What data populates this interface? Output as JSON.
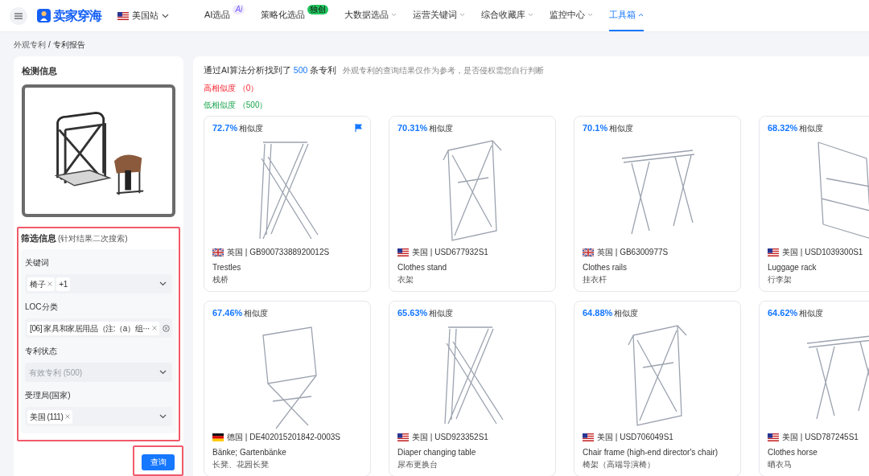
{
  "header": {
    "site": "美国站",
    "logo_text": "卖家穿海",
    "nav": [
      {
        "label": "AI选品",
        "badge": {
          "text": "Ai",
          "kind": "ai"
        },
        "caret": false,
        "selected": false
      },
      {
        "label": "策略化选品",
        "badge": {
          "text": "独创",
          "kind": "new"
        },
        "caret": false,
        "selected": false
      },
      {
        "label": "大数据选品",
        "caret": true,
        "selected": false
      },
      {
        "label": "运营关键词",
        "caret": true,
        "selected": false
      },
      {
        "label": "综合收藏库",
        "caret": true,
        "selected": false
      },
      {
        "label": "监控中心",
        "caret": true,
        "selected": false
      },
      {
        "label": "工具箱",
        "caret": true,
        "selected": true
      }
    ]
  },
  "breadcrumb": {
    "items": [
      "外观专利",
      "专利报告"
    ],
    "separator": "/"
  },
  "sidebar": {
    "title": "检测信息",
    "filter": {
      "title": "筛选信息",
      "note": "(针对结果二次搜索)",
      "fields": [
        {
          "label": "关键词",
          "tags": [
            {
              "text": "椅子",
              "removable": true
            },
            {
              "text": "+1",
              "removable": false
            }
          ],
          "clearable": false,
          "disabled": false
        },
        {
          "label": "LOC分类",
          "tags": [
            {
              "text": "[06] 家具和家居用品（注:（a）组···",
              "removable": true
            }
          ],
          "clearable": true,
          "disabled": false
        },
        {
          "label": "专利状态",
          "placeholder": "有效专利 (500)",
          "clearable": false,
          "disabled": true
        },
        {
          "label": "受理局(国家)",
          "tags": [
            {
              "text": "美国 (111)",
              "removable": true
            }
          ],
          "clearable": false,
          "disabled": false
        }
      ]
    },
    "query_button": "查询"
  },
  "results": {
    "summary_prefix": "通过AI算法分析找到了",
    "summary_count": "500",
    "summary_suffix": "条专利",
    "disclaimer": "外观专利的查询结果仅作为参考，是否侵权需您自行判断",
    "groups": [
      {
        "label": "高相似度",
        "count": "（0）",
        "kind": "high"
      },
      {
        "label": "低相似度",
        "count": "（500）",
        "kind": "low"
      }
    ],
    "cards": [
      {
        "score": "72.7%",
        "score_label": "相似度",
        "flagged": true,
        "country": {
          "kind": "gb",
          "text": "英国 | GB90073388920012S"
        },
        "title": "Trestles",
        "subtitle": "栈桥"
      },
      {
        "score": "70.31%",
        "score_label": "相似度",
        "flagged": false,
        "country": {
          "kind": "us",
          "text": "美国 | USD677932S1"
        },
        "title": "Clothes stand",
        "subtitle": "衣架"
      },
      {
        "score": "70.1%",
        "score_label": "相似度",
        "flagged": false,
        "country": {
          "kind": "gb",
          "text": "英国 | GB6300977S"
        },
        "title": "Clothes rails",
        "subtitle": "挂衣杆"
      },
      {
        "score": "68.32%",
        "score_label": "相似度",
        "flagged": false,
        "country": {
          "kind": "us",
          "text": "美国 | USD1039300S1"
        },
        "title": "Luggage rack",
        "subtitle": "行李架"
      },
      {
        "score": "67.46%",
        "score_label": "相似度",
        "flagged": false,
        "country": {
          "kind": "de",
          "text": "德国 | DE402015201842-0003S"
        },
        "title": "Bänke; Gartenbänke",
        "subtitle": "长凳、花园长凳"
      },
      {
        "score": "65.63%",
        "score_label": "相似度",
        "flagged": false,
        "country": {
          "kind": "us",
          "text": "美国 | USD923352S1"
        },
        "title": "Diaper changing table",
        "subtitle": "尿布更换台"
      },
      {
        "score": "64.88%",
        "score_label": "相似度",
        "flagged": false,
        "country": {
          "kind": "us",
          "text": "美国 | USD706049S1"
        },
        "title": "Chair frame (high-end director's chair)",
        "subtitle": "椅架（高端导演椅）"
      },
      {
        "score": "64.62%",
        "score_label": "相似度",
        "flagged": false,
        "country": {
          "kind": "us",
          "text": "美国 | USD787245S1"
        },
        "title": "Clothes horse",
        "subtitle": "晒衣马"
      }
    ]
  }
}
